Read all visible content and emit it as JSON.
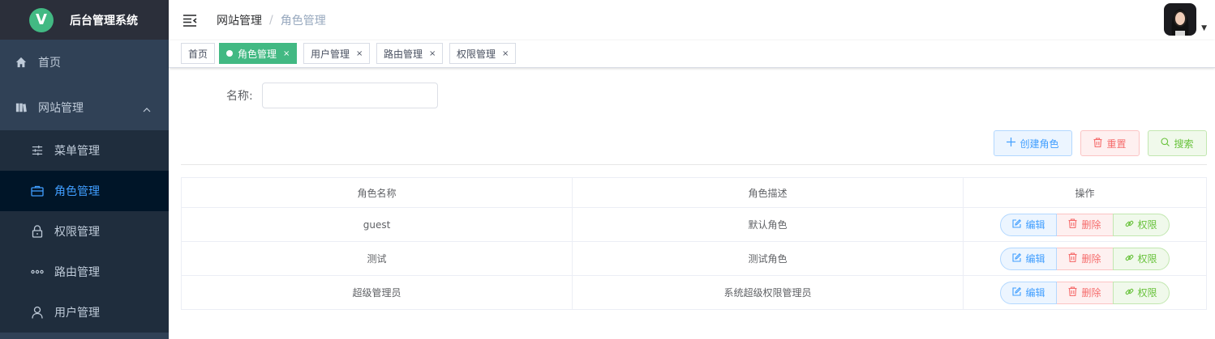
{
  "app": {
    "title": "后台管理系统",
    "logo_letter": "V"
  },
  "sidebar": {
    "items": [
      {
        "label": "首页",
        "icon": "home-icon"
      },
      {
        "label": "网站管理",
        "icon": "book-icon",
        "expanded": true
      }
    ],
    "subitems": [
      {
        "label": "菜单管理",
        "icon": "sliders-icon"
      },
      {
        "label": "角色管理",
        "icon": "briefcase-icon",
        "active": true
      },
      {
        "label": "权限管理",
        "icon": "lock-icon"
      },
      {
        "label": "路由管理",
        "icon": "more-dots-icon"
      },
      {
        "label": "用户管理",
        "icon": "user-icon"
      }
    ],
    "colors": {
      "bg": "#304156",
      "active_text": "#409eff"
    }
  },
  "header": {
    "breadcrumb": [
      "网站管理",
      "角色管理"
    ],
    "separator": "/"
  },
  "tags": [
    {
      "label": "首页",
      "closable": false
    },
    {
      "label": "角色管理",
      "active": true,
      "closable": true
    },
    {
      "label": "用户管理",
      "closable": true
    },
    {
      "label": "路由管理",
      "closable": true
    },
    {
      "label": "权限管理",
      "closable": true
    }
  ],
  "tag_close": "×",
  "search": {
    "label": "名称:",
    "value": "",
    "placeholder": ""
  },
  "toolbar": {
    "create_label": "创建角色",
    "reset_label": "重置",
    "search_label": "搜索"
  },
  "table": {
    "headers": [
      "角色名称",
      "角色描述",
      "操作"
    ],
    "rows": [
      {
        "name": "guest",
        "desc": "默认角色"
      },
      {
        "name": "测试",
        "desc": "测试角色"
      },
      {
        "name": "超级管理员",
        "desc": "系统超级权限管理员"
      }
    ],
    "actions": {
      "edit": "编辑",
      "delete": "删除",
      "permission": "权限"
    }
  },
  "colors": {
    "accent": "#42b983",
    "primary": "#409eff",
    "danger": "#f56c6c",
    "success": "#67c23a"
  }
}
